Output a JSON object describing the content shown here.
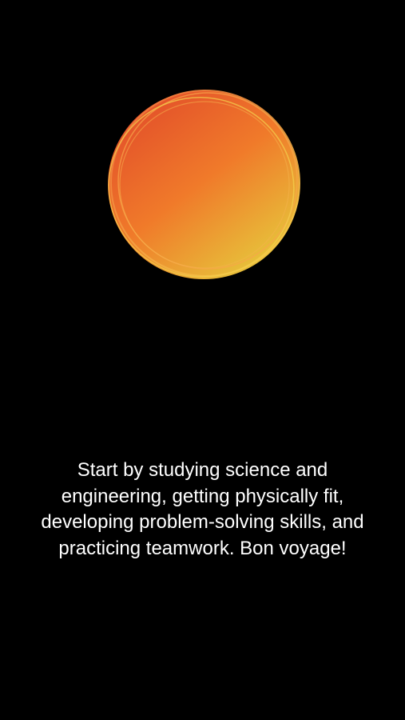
{
  "response": {
    "message": "Start by studying science and engineering, getting physically fit, developing problem-solving skills, and practicing teamwork. Bon voyage!"
  },
  "orb": {
    "icon": "siri-orb-icon",
    "colors": {
      "top": "#e4542a",
      "middle": "#f07a2a",
      "bottom": "#e6c93c",
      "ring": "#f6d24a"
    }
  },
  "background": "#000000"
}
